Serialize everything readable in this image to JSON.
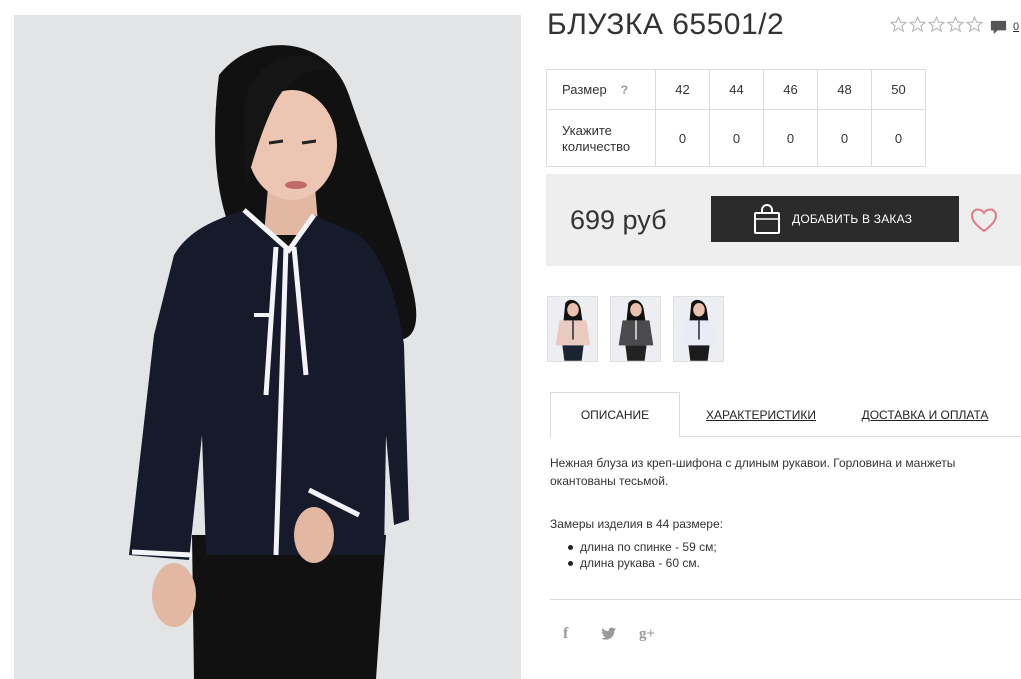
{
  "product": {
    "title": "БЛУЗКА 65501/2",
    "rating_stars": 0,
    "rating_max": 5,
    "comment_count": "0"
  },
  "size_table": {
    "size_label": "Размер",
    "help_mark": "?",
    "qty_label_line1": "Укажите",
    "qty_label_line2": "количество",
    "sizes": [
      "42",
      "44",
      "46",
      "48",
      "50"
    ],
    "quantities": [
      "0",
      "0",
      "0",
      "0",
      "0"
    ]
  },
  "order": {
    "price": "699 руб",
    "add_button_label": "ДОБАВИТЬ В ЗАКАЗ"
  },
  "thumbnails": [
    {
      "name": "thumb-pink",
      "top_color": "#e9c9c0"
    },
    {
      "name": "thumb-grey",
      "top_color": "#4b4b4e"
    },
    {
      "name": "thumb-white",
      "top_color": "#e9ecf4"
    }
  ],
  "tabs": [
    {
      "label": "ОПИСАНИЕ",
      "active": true
    },
    {
      "label": "ХАРАКТЕРИСТИКИ",
      "active": false
    },
    {
      "label": "ДОСТАВКА И ОПЛАТА",
      "active": false
    }
  ],
  "description": {
    "text": "Нежная блуза из креп-шифона с длиным рукавои. Горловина и манжеты окантованы тесьмой.",
    "measure_title": "Замеры изделия в 44 размере:",
    "measures": [
      "длина по спинке - 59 см;",
      "длина рукава - 60 см."
    ]
  },
  "social": {
    "facebook_glyph": "f",
    "gplus_glyph": "g+"
  },
  "colors": {
    "button_bg": "#2b2b2b",
    "order_bar_bg": "#eeeeee",
    "wishlist_heart": "#e07a8a",
    "blouse": "#161a2b",
    "photo_bg": "#e3e4e6"
  }
}
